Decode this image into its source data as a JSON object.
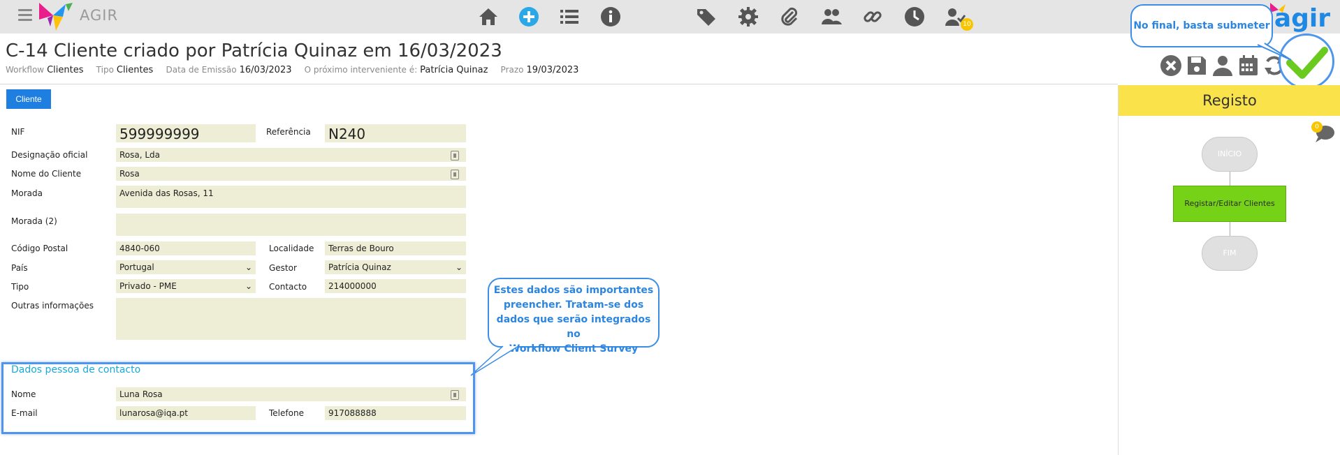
{
  "app": {
    "title": "AGIR",
    "brand": "agir",
    "accent": "#1f7fe0"
  },
  "nav_icons": [
    "home-icon",
    "add-circle-icon",
    "list-icon",
    "info-icon",
    "tags-icon",
    "gear-icon",
    "paperclip-icon",
    "users-icon",
    "link-icon",
    "clock-icon",
    "user-check-icon"
  ],
  "nav_badge": "10",
  "header": {
    "title": "C-14 Cliente criado por Patrícia Quinaz em 16/03/2023",
    "meta": [
      {
        "label": "Workflow",
        "value": "Clientes"
      },
      {
        "label": "Tipo",
        "value": "Clientes"
      },
      {
        "label": "Data de Emissão",
        "value": "16/03/2023"
      },
      {
        "label": "O próximo interveniente é:",
        "value": "Patrícia Quinaz"
      },
      {
        "label": "Prazo",
        "value": "19/03/2023"
      }
    ]
  },
  "actions": [
    "close-icon",
    "save-icon",
    "user-icon",
    "calendar-icon",
    "refresh-icon",
    "submit-check-icon"
  ],
  "tab": {
    "label": "Cliente"
  },
  "form": {
    "nif_label": "NIF",
    "nif": "599999999",
    "ref_label": "Referência",
    "ref": "N240",
    "designacao_label": "Designação oficial",
    "designacao": "Rosa, Lda",
    "nome_label": "Nome do Cliente",
    "nome": "Rosa",
    "morada_label": "Morada",
    "morada": "Avenida das Rosas, 11",
    "morada2_label": "Morada (2)",
    "morada2": "",
    "cp_label": "Código Postal",
    "cp": "4840-060",
    "localidade_label": "Localidade",
    "localidade": "Terras de Bouro",
    "pais_label": "País",
    "pais": "Portugal",
    "gestor_label": "Gestor",
    "gestor": "Patrícia Quinaz",
    "tipo_label": "Tipo",
    "tipo": "Privado - PME",
    "contacto_label": "Contacto",
    "contacto": "214000000",
    "outras_label": "Outras informações",
    "outras": ""
  },
  "contact": {
    "title": "Dados pessoa de contacto",
    "nome_label": "Nome",
    "nome": "Luna Rosa",
    "email_label": "E-mail",
    "email": "lunarosa@iqa.pt",
    "telefone_label": "Telefone",
    "telefone": "917088888"
  },
  "callouts": {
    "submit": "No final, basta submeter",
    "data": [
      "Estes dados são importantes",
      "preencher. Tratam-se dos",
      "dados que serão integrados no",
      "Workflow Client Survey"
    ]
  },
  "sidebar": {
    "title": "Registo",
    "chat_badge": "0",
    "nodes": {
      "start": "INÍCIO",
      "task": "Registar/Editar Clientes",
      "end": "FIM"
    }
  }
}
